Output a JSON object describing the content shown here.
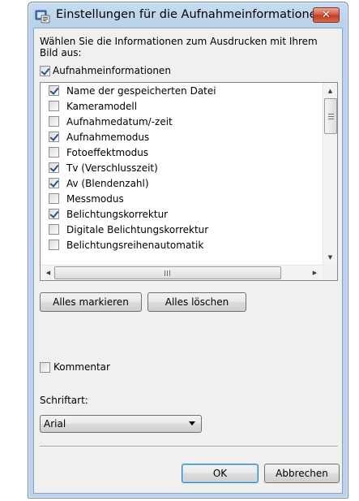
{
  "window": {
    "title": "Einstellungen für die Aufnahmeinformationen",
    "close_label": "✕"
  },
  "intro_text": "Wählen Sie die Informationen zum Ausdrucken mit Ihrem Bild aus:",
  "master_checkbox": {
    "label": "Aufnahmeinformationen",
    "checked": true
  },
  "list": {
    "items": [
      {
        "label": "Name der gespeicherten Datei",
        "checked": true
      },
      {
        "label": "Kameramodell",
        "checked": false
      },
      {
        "label": "Aufnahmedatum/-zeit",
        "checked": false
      },
      {
        "label": "Aufnahmemodus",
        "checked": true
      },
      {
        "label": "Fotoeffektmodus",
        "checked": false
      },
      {
        "label": "Tv (Verschlusszeit)",
        "checked": true
      },
      {
        "label": "Av (Blendenzahl)",
        "checked": true
      },
      {
        "label": "Messmodus",
        "checked": false
      },
      {
        "label": "Belichtungskorrektur",
        "checked": true
      },
      {
        "label": "Digitale Belichtungskorrektur",
        "checked": false
      },
      {
        "label": "Belichtungsreihenautomatik",
        "checked": false
      }
    ]
  },
  "buttons": {
    "select_all": "Alles markieren",
    "clear_all": "Alles löschen",
    "ok": "OK",
    "cancel": "Abbrechen"
  },
  "comment_checkbox": {
    "label": "Kommentar",
    "checked": false
  },
  "font": {
    "label": "Schriftart:",
    "value": "Arial"
  },
  "colors": {
    "title_bar": "#c7dcef",
    "dialog_bg": "#f0f0f0",
    "close_button": "#d6583f",
    "check_mark": "#2a4f8f"
  }
}
